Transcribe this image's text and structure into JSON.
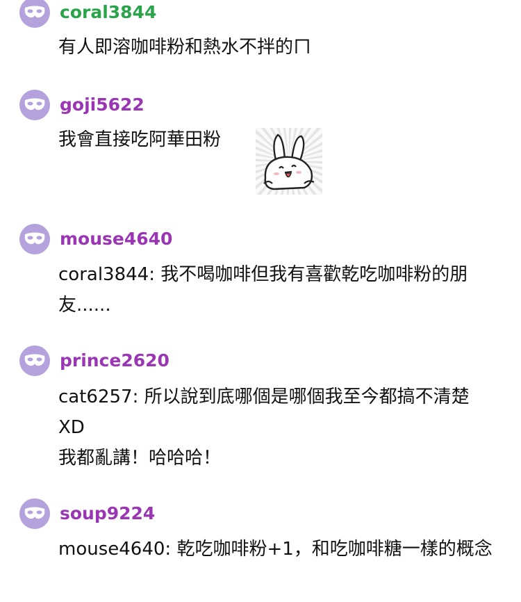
{
  "colors": {
    "avatar_bg": "#b4a2dc",
    "username_green": "#2aa34a",
    "username_purple": "#9a35b4",
    "text": "#111111"
  },
  "comments": [
    {
      "username": "coral3844",
      "username_color": "#2aa34a",
      "avatar_icon": "mask-icon",
      "text": "有人即溶咖啡粉和熱水不拌的ㄇ"
    },
    {
      "username": "goji5622",
      "username_color": "#9a35b4",
      "avatar_icon": "mask-icon",
      "text": "我會直接吃阿華田粉",
      "sticker": "rabbit-sticker-icon"
    },
    {
      "username": "mouse4640",
      "username_color": "#9a35b4",
      "avatar_icon": "mask-icon",
      "text": "coral3844: 我不喝咖啡但我有喜歡乾吃咖啡粉的朋友......"
    },
    {
      "username": "prince2620",
      "username_color": "#9a35b4",
      "avatar_icon": "mask-icon",
      "text": "cat6257: 所以說到底哪個是哪個我至今都搞不清楚XD\n我都亂講！哈哈哈！"
    },
    {
      "username": "soup9224",
      "username_color": "#9a35b4",
      "avatar_icon": "mask-icon",
      "text": "mouse4640: 乾吃咖啡粉+1，和吃咖啡糖一樣的概念"
    }
  ]
}
